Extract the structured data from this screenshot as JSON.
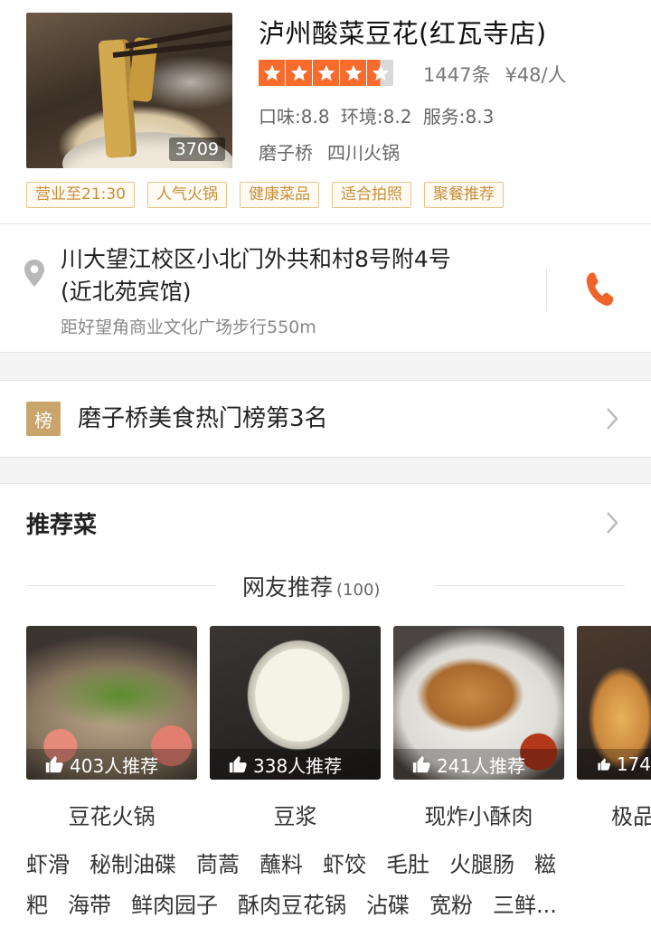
{
  "shop": {
    "name": "泸州酸菜豆花(红瓦寺店)",
    "photo_count": "3709",
    "rating_stars": 4.5,
    "reviews": "1447条",
    "price": "¥48/人",
    "scores": [
      "口味:8.8",
      "环境:8.2",
      "服务:8.3"
    ],
    "area": "磨子桥",
    "category": "四川火锅",
    "tags": [
      "营业至21:30",
      "人气火锅",
      "健康菜品",
      "适合拍照",
      "聚餐推荐"
    ]
  },
  "address": {
    "line1": "川大望江校区小北门外共和村8号附4号",
    "line2": "(近北苑宾馆)",
    "distance": "距好望角商业文化广场步行550m",
    "icon": "location-pin-icon",
    "phone_icon": "phone-icon"
  },
  "ranking": {
    "badge": "榜",
    "text": "磨子桥美食热门榜第3名"
  },
  "recommend": {
    "title": "推荐菜",
    "net_title": "网友推荐",
    "net_count": "(100)",
    "dishes": [
      {
        "name": "豆花火锅",
        "count": "403人推荐"
      },
      {
        "name": "豆浆",
        "count": "338人推荐"
      },
      {
        "name": "现炸小酥肉",
        "count": "241人推荐"
      },
      {
        "name": "极品",
        "count": "174"
      }
    ],
    "more_line1": [
      "虾滑",
      "秘制油碟",
      "茼蒿",
      "蘸料",
      "虾饺",
      "毛肚",
      "火腿肠",
      "糍"
    ],
    "more_line2": [
      "粑",
      "海带",
      "鲜肉园子",
      "酥肉豆花锅",
      "沾碟",
      "宽粉",
      "三鲜..."
    ]
  },
  "colors": {
    "accent": "#f76b2c",
    "tag_border": "#e7c289",
    "tag_text": "#c98e3a",
    "rank_badge": "#c9a46b",
    "phone": "#f0632a"
  }
}
